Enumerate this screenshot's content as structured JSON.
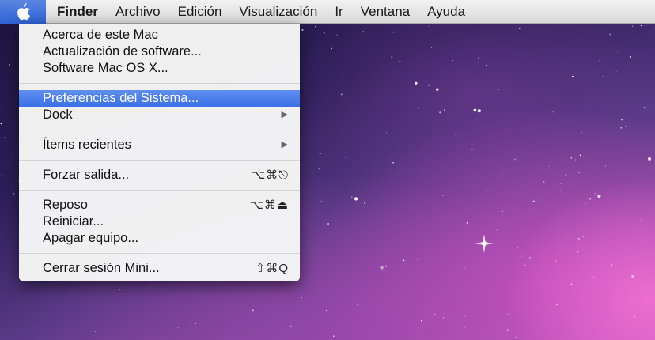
{
  "menubar": {
    "apple_icon": "apple-logo",
    "app_name": "Finder",
    "menus": [
      "Archivo",
      "Edición",
      "Visualización",
      "Ir",
      "Ventana",
      "Ayuda"
    ]
  },
  "apple_menu": {
    "groups": [
      [
        {
          "label": "Acerca de este Mac"
        },
        {
          "label": "Actualización de software..."
        },
        {
          "label": "Software Mac OS X..."
        }
      ],
      [
        {
          "label": "Preferencias del Sistema...",
          "highlighted": true
        },
        {
          "label": "Dock",
          "submenu": true
        }
      ],
      [
        {
          "label": "Ítems recientes",
          "submenu": true
        }
      ],
      [
        {
          "label": "Forzar salida...",
          "shortcut": "⌥⌘⎋"
        }
      ],
      [
        {
          "label": "Reposo",
          "shortcut": "⌥⌘⏏"
        },
        {
          "label": "Reiniciar..."
        },
        {
          "label": "Apagar equipo..."
        }
      ],
      [
        {
          "label": "Cerrar sesión Mini...",
          "shortcut": "⇧⌘Q"
        }
      ]
    ],
    "submenu_arrow": "▶"
  },
  "desktop": {
    "wallpaper_colors": [
      "#1d1440",
      "#5a3a86",
      "#c45fc0"
    ]
  }
}
